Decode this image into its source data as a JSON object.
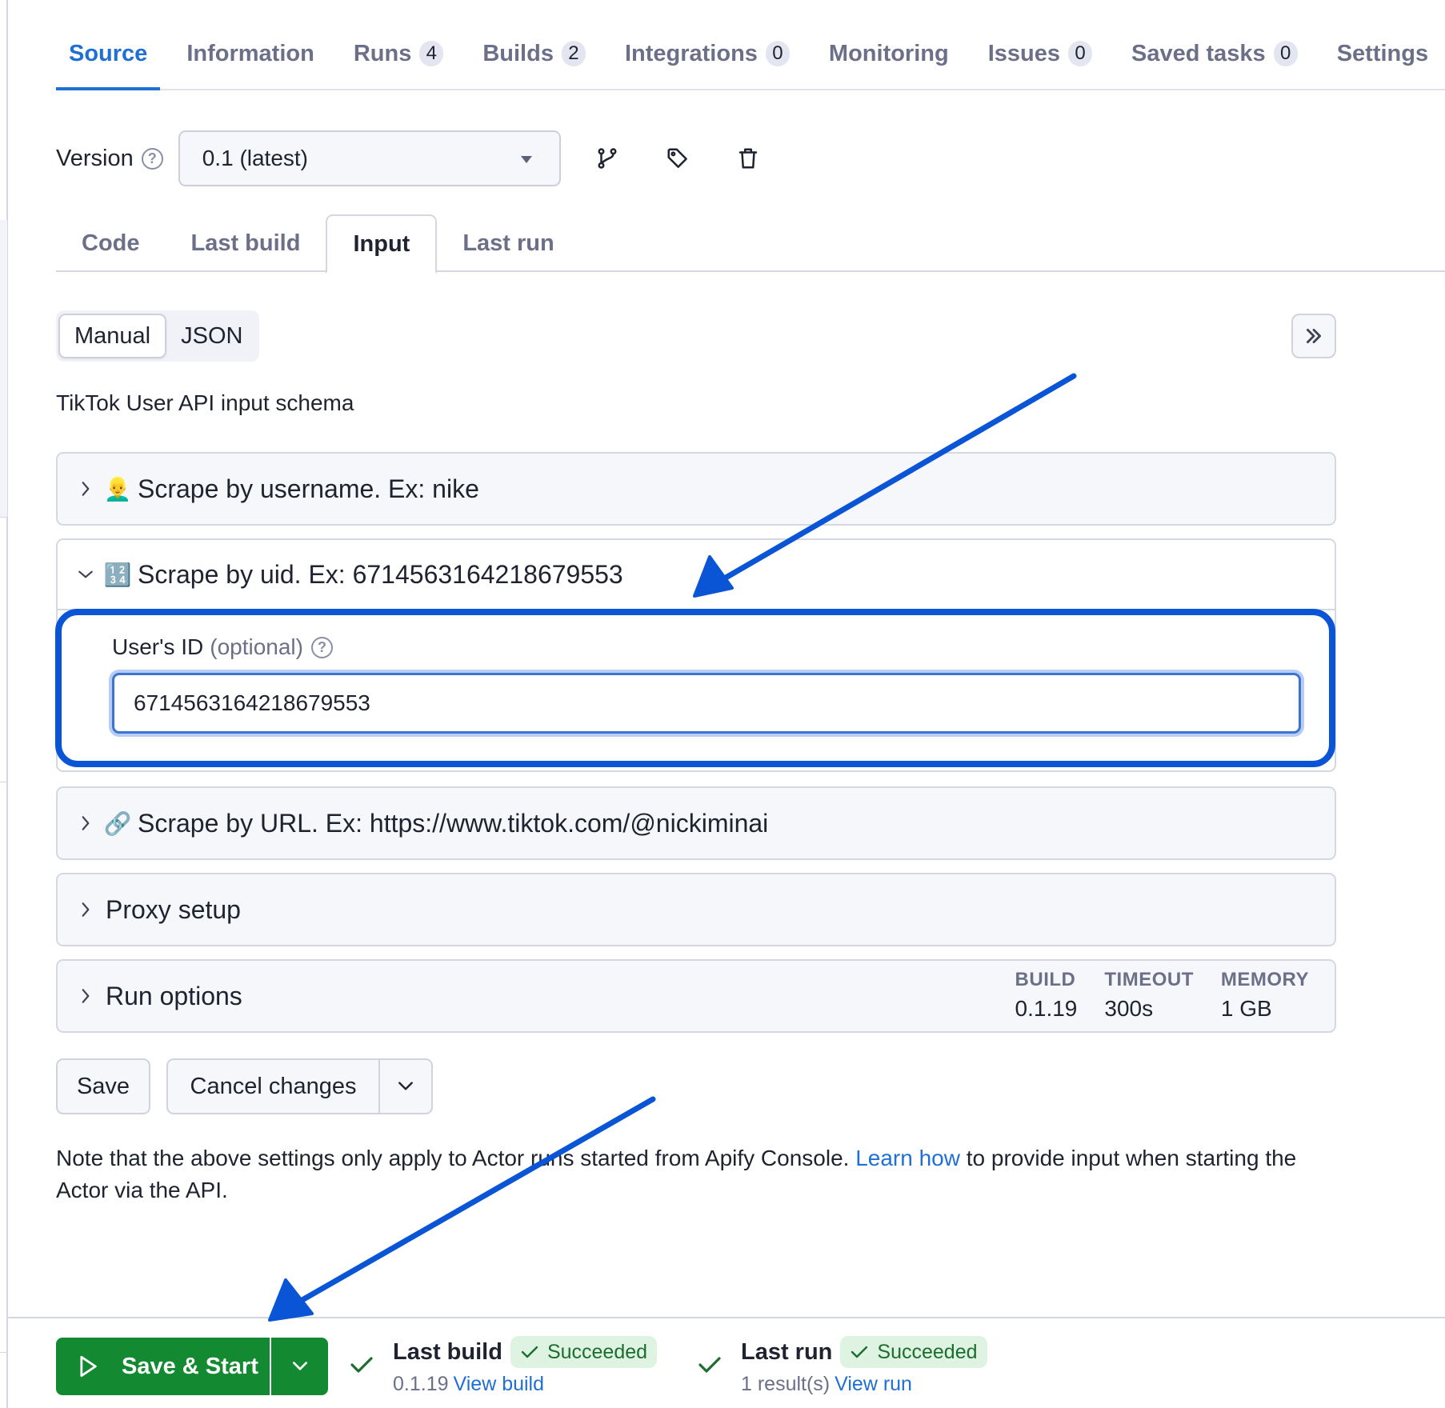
{
  "nav": {
    "tabs": [
      {
        "label": "Source",
        "badge": null,
        "active": true
      },
      {
        "label": "Information",
        "badge": null
      },
      {
        "label": "Runs",
        "badge": "4"
      },
      {
        "label": "Builds",
        "badge": "2"
      },
      {
        "label": "Integrations",
        "badge": "0"
      },
      {
        "label": "Monitoring",
        "badge": null
      },
      {
        "label": "Issues",
        "badge": "0"
      },
      {
        "label": "Saved tasks",
        "badge": "0"
      },
      {
        "label": "Settings",
        "badge": null
      }
    ]
  },
  "version": {
    "label": "Version",
    "help": "?",
    "selected": "0.1 (latest)",
    "icons": [
      "git-branch-icon",
      "tag-icon",
      "trash-icon"
    ]
  },
  "subtabs": [
    {
      "label": "Code"
    },
    {
      "label": "Last build"
    },
    {
      "label": "Input",
      "active": true
    },
    {
      "label": "Last run"
    }
  ],
  "mode": {
    "manual": "Manual",
    "json": "JSON",
    "selected": "Manual"
  },
  "schema_title": "TikTok User API input schema",
  "sections": {
    "username": {
      "emoji": "👱‍♂️",
      "title": "Scrape by username. Ex: nike",
      "expanded": false
    },
    "uid": {
      "emoji": "🔢",
      "title": "Scrape by uid. Ex: 6714563164218679553",
      "expanded": true,
      "field_label": "User's ID",
      "field_optional": "(optional)",
      "field_value": "6714563164218679553"
    },
    "url": {
      "emoji": "🔗",
      "title": "Scrape by URL. Ex: https://www.tiktok.com/@nickiminai",
      "expanded": false
    },
    "proxy": {
      "title": "Proxy setup",
      "expanded": false
    },
    "run_options": {
      "title": "Run options",
      "expanded": false,
      "build_label": "BUILD",
      "build_value": "0.1.19",
      "timeout_label": "TIMEOUT",
      "timeout_value": "300s",
      "memory_label": "MEMORY",
      "memory_value": "1 GB"
    }
  },
  "actions": {
    "save": "Save",
    "cancel": "Cancel changes"
  },
  "note": {
    "before": "Note that the above settings only apply to Actor runs started from Apify Console. ",
    "link": "Learn how",
    "after": " to provide input when starting the Actor via the API."
  },
  "footer": {
    "start": "Save & Start",
    "last_build": {
      "title": "Last build",
      "status": "Succeeded",
      "version": "0.1.19",
      "link": "View build"
    },
    "last_run": {
      "title": "Last run",
      "status": "Succeeded",
      "results": "1 result(s)",
      "link": "View run"
    }
  },
  "colors": {
    "accent": "#1f6fd6",
    "start_green": "#138a31",
    "success_bg": "#dff3e2",
    "success_text": "#1c6e2e",
    "annotation": "#0a55d6"
  }
}
